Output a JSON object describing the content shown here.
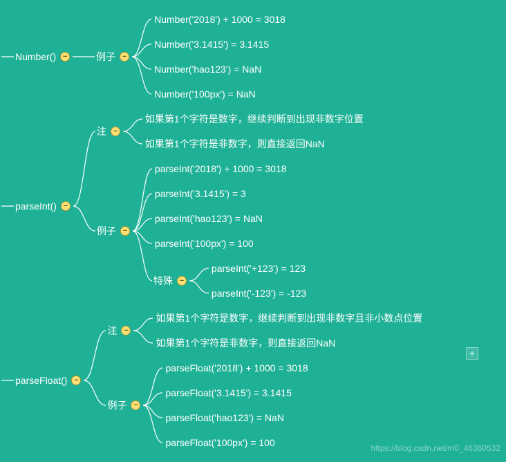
{
  "root": [
    {
      "label": "Number()",
      "children": [
        {
          "label": "例子",
          "leaves": [
            "Number('2018') + 1000 = 3018",
            "Number('3.1415') = 3.1415",
            "Number('hao123') = NaN",
            "Number('100px') = NaN"
          ]
        }
      ]
    },
    {
      "label": "parseInt()",
      "children": [
        {
          "label": "注",
          "leaves": [
            "如果第1个字符是数字，继续判断到出现非数字位置",
            "如果第1个字符是非数字，则直接返回NaN"
          ]
        },
        {
          "label": "例子",
          "leaves": [
            "parseInt('2018') + 1000 = 3018",
            "parseInt('3.1415') = 3",
            "parseInt('hao123') = NaN",
            "parseInt('100px') = 100"
          ],
          "sub": {
            "label": "特殊",
            "leaves": [
              "parseInt('+123') = 123",
              "parseInt('-123') = -123"
            ]
          }
        }
      ]
    },
    {
      "label": "parseFloat()",
      "children": [
        {
          "label": "注",
          "leaves": [
            "如果第1个字符是数字，继续判断到出现非数字且非小数点位置",
            "如果第1个字符是非数字，则直接返回NaN"
          ]
        },
        {
          "label": "例子",
          "leaves": [
            "parseFloat('2018') + 1000 = 3018",
            "parseFloat('3.1415') = 3.1415",
            "parseFloat('hao123') = NaN",
            "parseFloat('100px') = 100"
          ]
        }
      ]
    }
  ],
  "watermark": "https://blog.csdn.net/m0_46360532",
  "plus": "+"
}
